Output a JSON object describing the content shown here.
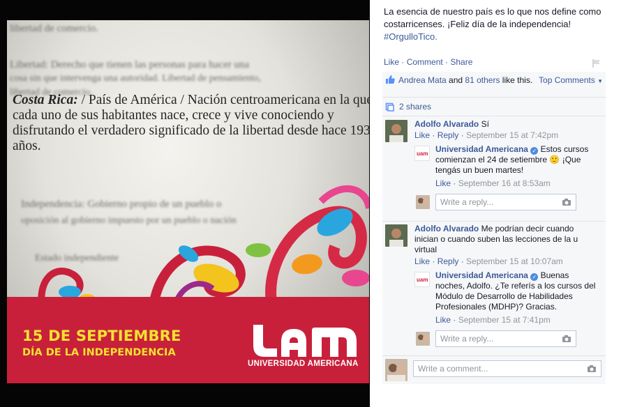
{
  "photo": {
    "blurred_lines": [
      "libertad de comercio.",
      "Libertad: Derecho que tienen las personas para hacer una",
      "cosa sin que intervenga una autoridad. Libertad de pensamiento,",
      "libertad de comercio.",
      "Independencia: Gobierno propio de un pueblo o",
      "oposición al gobierno impuesto por un pueblo o nación",
      "Estado independiente"
    ],
    "definition_term": "Costa Rica:",
    "definition_text": " / País de América / Nación centroamericana en la que cada uno de sus habitantes nace, crece y vive conociendo y disfrutando el verdadero significado de la libertad desde hace 193 años.",
    "banner_line1": "15 DE SEPTIEMBRE",
    "banner_line2": "DÍA DE LA INDEPENDENCIA",
    "brand_name": "UNIVERSIDAD AMERICANA",
    "banner_color": "#c8203b",
    "accent_yellow": "#f3e22f"
  },
  "post": {
    "caption": "La esencia de nuestro país es lo que nos define como costarricenses. ¡Feliz día de la independencia!",
    "hashtag": "#OrgulloTico.",
    "actions": {
      "like": "Like",
      "sep1": " · ",
      "comment": "Comment",
      "sep2": " · ",
      "share": "Share"
    },
    "likes": {
      "name": "Andrea Mata",
      "and": " and ",
      "others": "81 others",
      "suffix": " like this."
    },
    "top_comments": "Top Comments",
    "shares": "2 shares",
    "comments": [
      {
        "author": "Adolfo Alvarado",
        "text": " Sí",
        "like": "Like",
        "reply": "Reply",
        "time": "September 15 at 7:42pm",
        "reply_item": {
          "author": "Universidad Americana",
          "text": " Estos cursos comienzan el 24 de setiembre 🙂 ¡Que tengás un buen martes!",
          "like": "Like",
          "time": "September 16 at 8:53am"
        },
        "reply_placeholder": "Write a reply..."
      },
      {
        "author": "Adolfo Alvarado",
        "text": " Me podrían decir cuando inician o cuando suben las lecciones de la u virtual",
        "like": "Like",
        "reply": "Reply",
        "time": "September 15 at 10:07am",
        "reply_item": {
          "author": "Universidad Americana",
          "text": " Buenas noches, Adolfo. ¿Te referís a los cursos del Módulo de Desarrollo de Habilidades Profesionales (MDHP)? Gracias.",
          "like": "Like",
          "time": "September 15 at 7:41pm"
        },
        "reply_placeholder": "Write a reply..."
      }
    ],
    "comment_placeholder": "Write a comment...",
    "link_color": "#3b5998"
  }
}
